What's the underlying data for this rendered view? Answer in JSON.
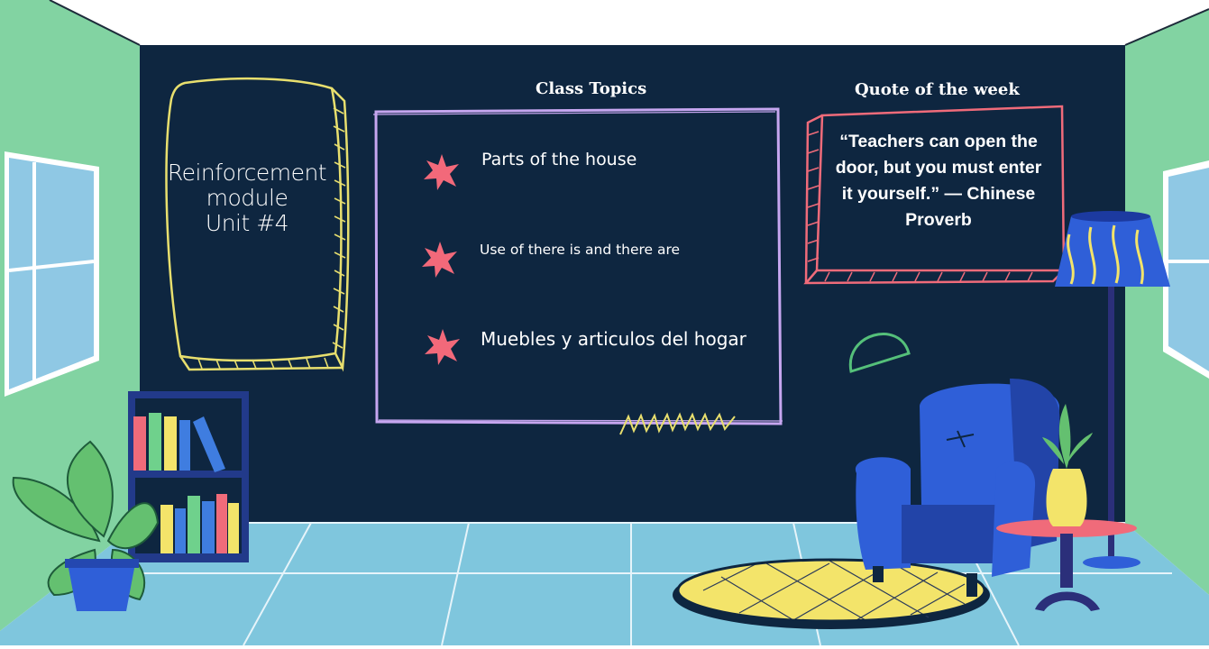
{
  "slide": {
    "title_lines": [
      "Reinforcement",
      "module",
      "Unit #4"
    ],
    "class_topics": {
      "heading": "Class Topics",
      "items": [
        "Parts of the house",
        "Use of there is and there are",
        "Muebles y articulos del hogar"
      ]
    },
    "quote": {
      "heading": "Quote of the week",
      "text": "“Teachers can open the door, but you must enter it yourself.” — Chinese Proverb"
    }
  },
  "colors": {
    "chalkboard": "#0e2640",
    "side_walls": "#82d3a2",
    "floor": "#7fc6dd",
    "yellow_frame": "#e8df6e",
    "purple_frame": "#c6a6f0",
    "pink_frame": "#f06b7a",
    "bullet_star": "#f2697a",
    "armchair": "#2f5fd8",
    "rug": "#f3e46a"
  },
  "icons": [
    "star-bullet-icon",
    "zigzag-scribble",
    "half-circle-doodle"
  ]
}
